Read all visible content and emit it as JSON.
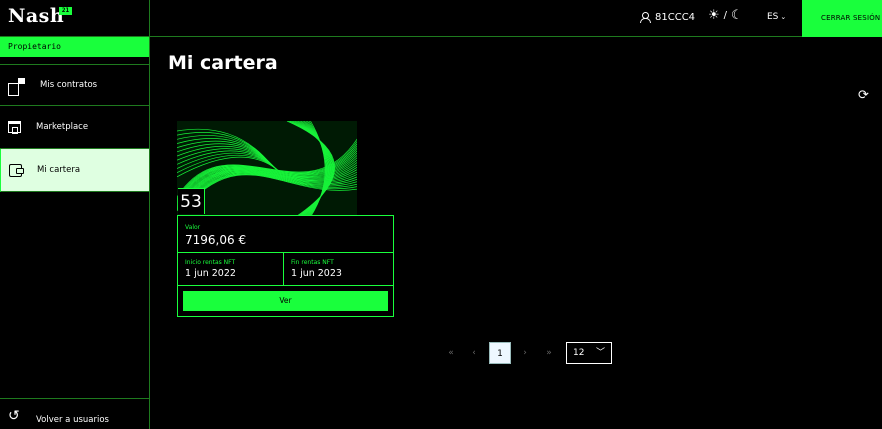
{
  "header": {
    "logo_text": "Nash",
    "logo_badge": "21",
    "user_id": "81CCC4",
    "theme_separator": "/",
    "language": "ES",
    "logout_label": "CERRAR SESIÓN"
  },
  "sidebar": {
    "role": "Propietario",
    "items": [
      {
        "label": "Mis contratos",
        "icon": "contracts-icon"
      },
      {
        "label": "Marketplace",
        "icon": "store-icon"
      },
      {
        "label": "Mi cartera",
        "icon": "wallet-icon",
        "active": true
      }
    ],
    "back_label": "Volver a usuarios"
  },
  "main": {
    "title": "Mi cartera",
    "card": {
      "number": "53",
      "value_label": "Valor",
      "value": "7196,06 €",
      "start_label": "Inicio rentas NFT",
      "start_date": "1 jun 2022",
      "end_label": "Fin rentas NFT",
      "end_date": "1 jun 2023",
      "button_label": "Ver"
    },
    "pagination": {
      "first": "«",
      "prev": "‹",
      "current": "1",
      "next": "›",
      "last": "»",
      "page_size": "12"
    }
  },
  "colors": {
    "accent": "#19ff3c",
    "border": "#1e7a1e",
    "background": "#000000",
    "active_item_bg": "#dfffe1"
  }
}
